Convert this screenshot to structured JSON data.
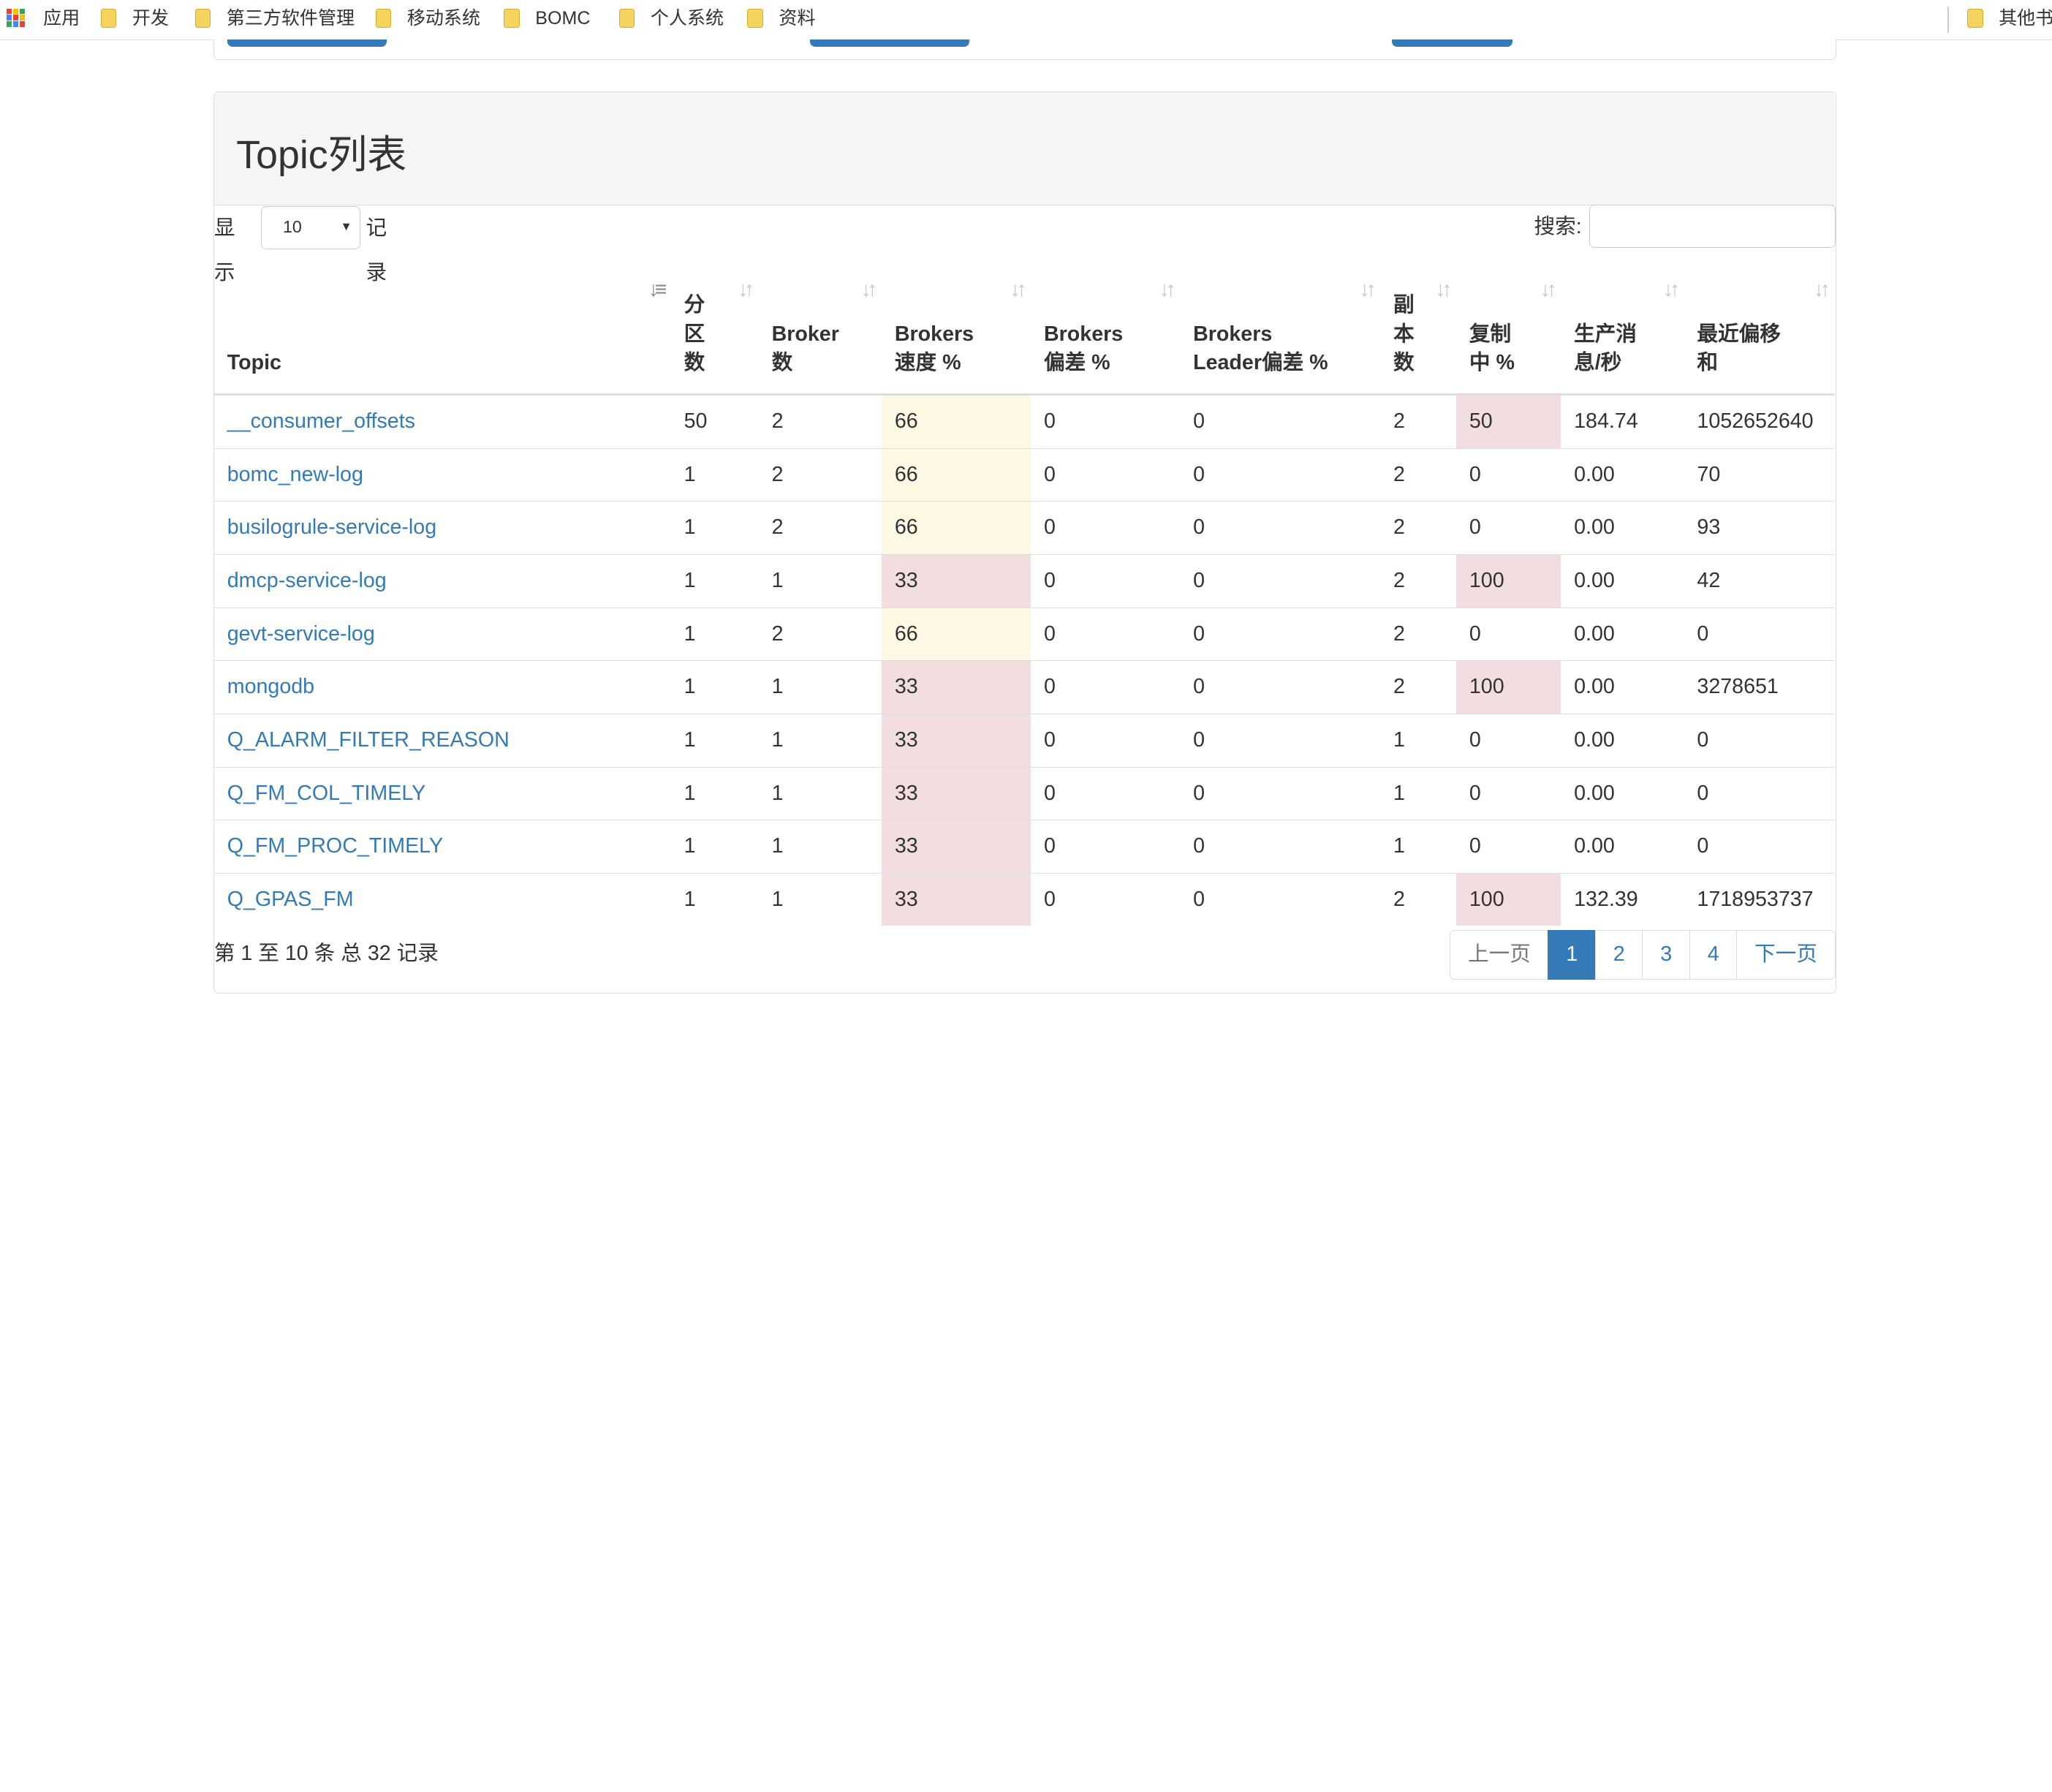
{
  "bookmarks": {
    "apps_label": "应用",
    "items": [
      "开发",
      "第三方软件管理",
      "移动系统",
      "BOMC",
      "个人系统",
      "资料"
    ],
    "other_label": "其他书"
  },
  "panel": {
    "title": "Topic列表"
  },
  "length": {
    "show_label": "显示",
    "value": "10",
    "records_label": "记录"
  },
  "search": {
    "label": "搜索:",
    "value": ""
  },
  "table": {
    "columns": [
      {
        "label": "Topic",
        "lines": [
          "Topic"
        ]
      },
      {
        "label": "分区数",
        "lines": [
          "分",
          "区",
          "数"
        ]
      },
      {
        "label": "Broker数",
        "lines": [
          "Broker",
          "数"
        ]
      },
      {
        "label": "Brokers速度 %",
        "lines": [
          "Brokers",
          "速度 %"
        ]
      },
      {
        "label": "Brokers偏差 %",
        "lines": [
          "Brokers",
          "偏差 %"
        ]
      },
      {
        "label": "Brokers Leader偏差 %",
        "lines": [
          "Brokers",
          "Leader偏差 %"
        ]
      },
      {
        "label": "副本数",
        "lines": [
          "副",
          "本",
          "数"
        ]
      },
      {
        "label": "复制中 %",
        "lines": [
          "复制",
          "中 %"
        ]
      },
      {
        "label": "生产消息/秒",
        "lines": [
          "生产消",
          "息/秒"
        ]
      },
      {
        "label": "最近偏移和",
        "lines": [
          "最近偏移",
          "和"
        ]
      }
    ],
    "rows": [
      {
        "topic": "__consumer_offsets",
        "partitions": "50",
        "brokers": "2",
        "spread": "66",
        "skew": "0",
        "leader_skew": "0",
        "replicas": "2",
        "under_replicated": "50",
        "msgs_per_sec": "184.74",
        "offset_sum": "1052652640"
      },
      {
        "topic": "bomc_new-log",
        "partitions": "1",
        "brokers": "2",
        "spread": "66",
        "skew": "0",
        "leader_skew": "0",
        "replicas": "2",
        "under_replicated": "0",
        "msgs_per_sec": "0.00",
        "offset_sum": "70"
      },
      {
        "topic": "busilogrule-service-log",
        "partitions": "1",
        "brokers": "2",
        "spread": "66",
        "skew": "0",
        "leader_skew": "0",
        "replicas": "2",
        "under_replicated": "0",
        "msgs_per_sec": "0.00",
        "offset_sum": "93"
      },
      {
        "topic": "dmcp-service-log",
        "partitions": "1",
        "brokers": "1",
        "spread": "33",
        "skew": "0",
        "leader_skew": "0",
        "replicas": "2",
        "under_replicated": "100",
        "msgs_per_sec": "0.00",
        "offset_sum": "42"
      },
      {
        "topic": "gevt-service-log",
        "partitions": "1",
        "brokers": "2",
        "spread": "66",
        "skew": "0",
        "leader_skew": "0",
        "replicas": "2",
        "under_replicated": "0",
        "msgs_per_sec": "0.00",
        "offset_sum": "0"
      },
      {
        "topic": "mongodb",
        "partitions": "1",
        "brokers": "1",
        "spread": "33",
        "skew": "0",
        "leader_skew": "0",
        "replicas": "2",
        "under_replicated": "100",
        "msgs_per_sec": "0.00",
        "offset_sum": "3278651"
      },
      {
        "topic": "Q_ALARM_FILTER_REASON",
        "partitions": "1",
        "brokers": "1",
        "spread": "33",
        "skew": "0",
        "leader_skew": "0",
        "replicas": "1",
        "under_replicated": "0",
        "msgs_per_sec": "0.00",
        "offset_sum": "0"
      },
      {
        "topic": "Q_FM_COL_TIMELY",
        "partitions": "1",
        "brokers": "1",
        "spread": "33",
        "skew": "0",
        "leader_skew": "0",
        "replicas": "1",
        "under_replicated": "0",
        "msgs_per_sec": "0.00",
        "offset_sum": "0"
      },
      {
        "topic": "Q_FM_PROC_TIMELY",
        "partitions": "1",
        "brokers": "1",
        "spread": "33",
        "skew": "0",
        "leader_skew": "0",
        "replicas": "1",
        "under_replicated": "0",
        "msgs_per_sec": "0.00",
        "offset_sum": "0"
      },
      {
        "topic": "Q_GPAS_FM",
        "partitions": "1",
        "brokers": "1",
        "spread": "33",
        "skew": "0",
        "leader_skew": "0",
        "replicas": "2",
        "under_replicated": "100",
        "msgs_per_sec": "132.39",
        "offset_sum": "1718953737"
      }
    ]
  },
  "info": "第 1 至 10 条 总 32 记录",
  "pagination": {
    "prev": "上一页",
    "pages": [
      "1",
      "2",
      "3",
      "4"
    ],
    "current": "1",
    "next": "下一页"
  },
  "colors": {
    "link": "#337ab7",
    "warning_bg": "#fcf8e3",
    "danger_bg": "#f2dede",
    "active_page": "#337ab7"
  },
  "icons": {
    "apps": "apps-grid-icon",
    "folder": "folder-icon",
    "sort": "sort-icon",
    "sort_active": "sort-desc-icon"
  }
}
